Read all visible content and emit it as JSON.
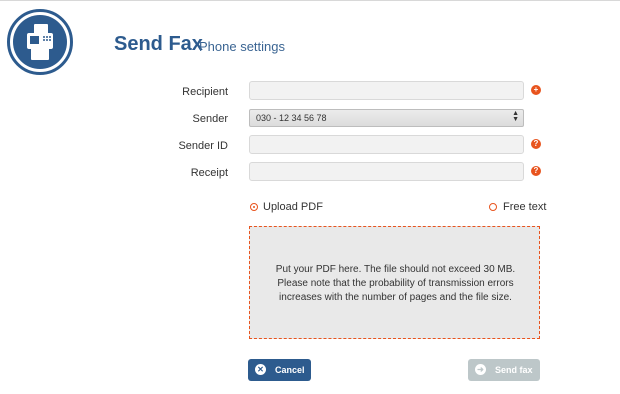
{
  "header": {
    "title": "Send Fax",
    "subtitle": "Phone settings"
  },
  "form": {
    "recipient_label": "Recipient",
    "recipient_value": "",
    "sender_label": "Sender",
    "sender_selected": "030 - 12 34 56 78",
    "sender_id_label": "Sender ID",
    "sender_id_value": "",
    "receipt_label": "Receipt",
    "receipt_value": ""
  },
  "mode": {
    "upload_label": "Upload PDF",
    "free_text_label": "Free text",
    "selected": "Upload PDF"
  },
  "dropzone": {
    "text": "Put your PDF here. The file should not exceed 30 MB. Please note that the probability of transmission errors increases with the number of pages and the file size."
  },
  "buttons": {
    "cancel_label": "Cancel",
    "send_label": "Send fax"
  },
  "icons": {
    "logo": "fax-machine-icon",
    "add": "plus-circle-icon",
    "help": "question-circle-icon",
    "cancel": "x-circle-icon",
    "send": "arrow-circle-icon"
  },
  "colors": {
    "brand_blue": "#2d5b8e",
    "accent_orange": "#e8541e",
    "disabled_button": "#bdc7c9"
  }
}
